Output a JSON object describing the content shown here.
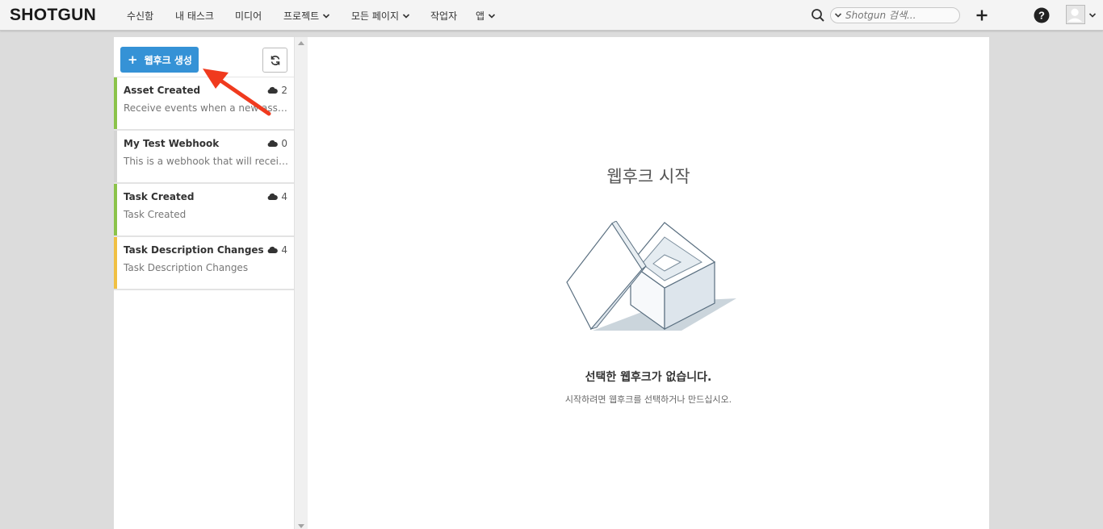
{
  "app": {
    "logo": "SHOTGUN"
  },
  "nav": {
    "items": [
      {
        "label": "수신함",
        "dropdown": false
      },
      {
        "label": "내 태스크",
        "dropdown": false
      },
      {
        "label": "미디어",
        "dropdown": false
      },
      {
        "label": "프로젝트",
        "dropdown": true
      },
      {
        "label": "모든 페이지",
        "dropdown": true
      },
      {
        "label": "작업자",
        "dropdown": false
      },
      {
        "label": "앱",
        "dropdown": true
      }
    ],
    "search_placeholder": "Shotgun 검색..."
  },
  "sidebar": {
    "create_button_label": "웹후크 생성",
    "webhooks": [
      {
        "title": "Asset Created",
        "description": "Receive events when a new asset ...",
        "count": "2",
        "status_color": "#8bc34a"
      },
      {
        "title": "My Test Webhook",
        "description": "This is a webhook that will receive...",
        "count": "0",
        "status_color": "#d4d4d4"
      },
      {
        "title": "Task Created",
        "description": "Task Created",
        "count": "4",
        "status_color": "#8bc34a"
      },
      {
        "title": "Task Description Changes",
        "description": "Task Description Changes",
        "count": "4",
        "status_color": "#f0c043"
      }
    ]
  },
  "main": {
    "heading": "웹후크 시작",
    "empty_title": "선택한 웹후크가 없습니다.",
    "empty_subtitle": "시작하려면 웹후크를 선택하거나 만드십시오."
  },
  "colors": {
    "accent": "#3592d6",
    "annotation_arrow": "#f03a1e"
  }
}
